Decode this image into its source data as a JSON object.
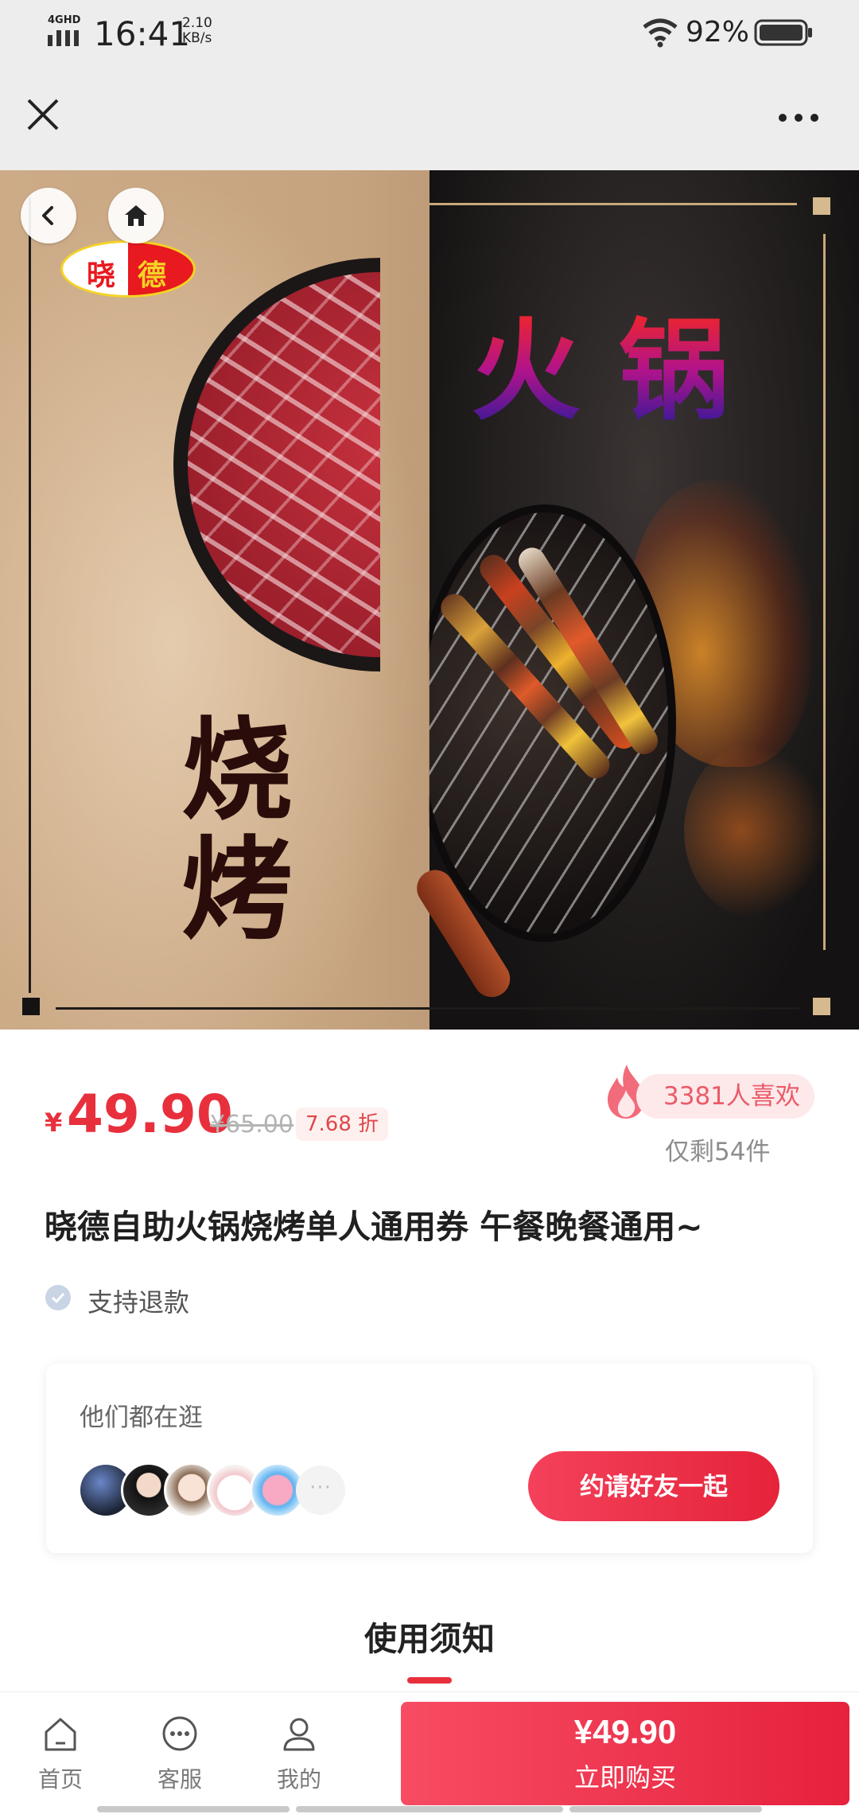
{
  "status_bar": {
    "network": "4GHD",
    "time": "16:41",
    "speed_value": "2.10",
    "speed_unit": "KB/s",
    "battery_percent": "92%"
  },
  "hero": {
    "logo_char1": "晓",
    "logo_char2": "德",
    "headline": "火锅",
    "subline": "烧烤"
  },
  "product": {
    "currency": "¥",
    "price": "49.90",
    "original_price": "¥65.00",
    "discount": "7.68 折",
    "likes": "3381人喜欢",
    "stock": "仅剩54件",
    "title": "晓德自助火锅烧烤单人通用券 午餐晚餐通用~",
    "refund": "支持退款"
  },
  "social": {
    "heading": "他们都在逛",
    "more": "···",
    "invite_label": "约请好友一起"
  },
  "notice": {
    "title": "使用须知"
  },
  "bottom_bar": {
    "home_label": "首页",
    "service_label": "客服",
    "mine_label": "我的",
    "buy_price": "¥49.90",
    "buy_label": "立即购买"
  },
  "colors": {
    "accent": "#e8303d",
    "button_gradient_start": "#f74c63",
    "button_gradient_end": "#e6213d",
    "chrome_bg": "#ededed"
  }
}
